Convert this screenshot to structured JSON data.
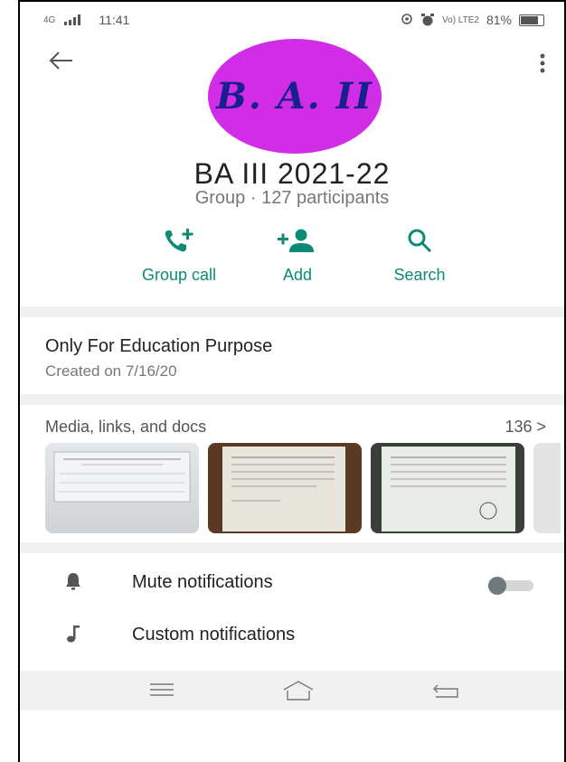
{
  "status_bar": {
    "network": "4G",
    "time": "11:41",
    "lte": "Vo) LTE2",
    "battery": "81%",
    "battery_level": 0.81
  },
  "group": {
    "title": "BA III  2021-22",
    "subtitle": "Group · 127 participants",
    "avatar_text": "B. A. II"
  },
  "actions": [
    {
      "label": "Group call",
      "icon": "phone-add-icon"
    },
    {
      "label": "Add",
      "icon": "add-person-icon"
    },
    {
      "label": "Search",
      "icon": "search-icon"
    }
  ],
  "description": {
    "text": "Only For Education Purpose",
    "created": "Created on 7/16/20"
  },
  "media": {
    "header": "Media, links, and docs",
    "count": "136 >"
  },
  "settings": {
    "mute_label": "Mute notifications",
    "custom_label": "Custom notifications"
  },
  "colors": {
    "accent": "#0b8a76",
    "avatar_bg": "#d12ce6",
    "avatar_text": "#18208f",
    "divider": "#f1f1f1"
  }
}
